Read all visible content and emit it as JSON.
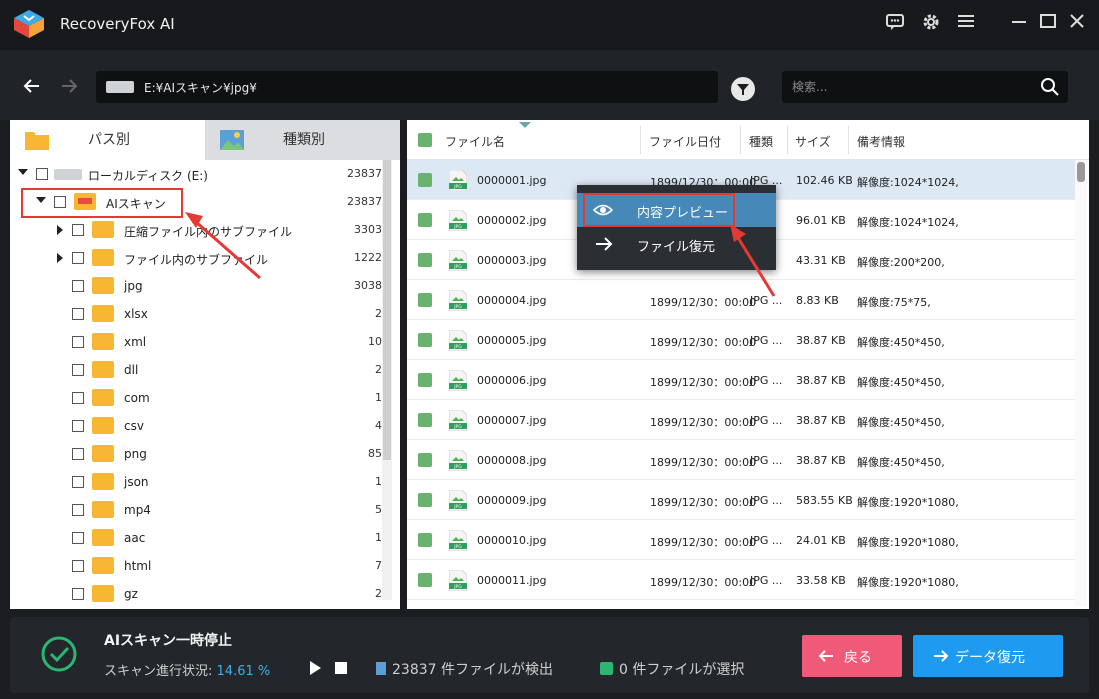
{
  "app": {
    "title": "RecoveryFox AI"
  },
  "toolbar": {
    "path": "E:¥AIスキャン¥jpg¥",
    "search_placeholder": "検索..."
  },
  "left": {
    "tabs": [
      {
        "label": "パス別"
      },
      {
        "label": "種類別"
      }
    ],
    "tree": [
      {
        "label": "ローカルディスク (E:)",
        "count": "23837"
      },
      {
        "label": "AIスキャン",
        "count": "23837"
      },
      {
        "label": "圧縮ファイル内のサブファイル",
        "count": "3303"
      },
      {
        "label": "ファイル内のサブファイル",
        "count": "1222"
      },
      {
        "label": "jpg",
        "count": "3038"
      },
      {
        "label": "xlsx",
        "count": "2"
      },
      {
        "label": "xml",
        "count": "10"
      },
      {
        "label": "dll",
        "count": "2"
      },
      {
        "label": "com",
        "count": "1"
      },
      {
        "label": "csv",
        "count": "4"
      },
      {
        "label": "png",
        "count": "85"
      },
      {
        "label": "json",
        "count": "1"
      },
      {
        "label": "mp4",
        "count": "5"
      },
      {
        "label": "aac",
        "count": "1"
      },
      {
        "label": "html",
        "count": "7"
      },
      {
        "label": "gz",
        "count": "2"
      }
    ]
  },
  "table": {
    "headers": [
      "ファイル名",
      "ファイル日付",
      "種類",
      "サイズ",
      "備考情報"
    ],
    "rows": [
      {
        "name": "0000001.jpg",
        "date": "1899/12/30：00:00",
        "type": "JPG ...",
        "size": "102.46 KB",
        "note": "解像度:1024*1024,"
      },
      {
        "name": "0000002.jpg",
        "date": "",
        "type": "",
        "size": "96.01 KB",
        "note": "解像度:1024*1024,"
      },
      {
        "name": "0000003.jpg",
        "date": "",
        "type": "",
        "size": "43.31 KB",
        "note": "解像度:200*200,"
      },
      {
        "name": "0000004.jpg",
        "date": "1899/12/30：00:00",
        "type": "JPG ...",
        "size": "8.83 KB",
        "note": "解像度:75*75,"
      },
      {
        "name": "0000005.jpg",
        "date": "1899/12/30：00:00",
        "type": "JPG ...",
        "size": "38.87 KB",
        "note": "解像度:450*450,"
      },
      {
        "name": "0000006.jpg",
        "date": "1899/12/30：00:00",
        "type": "JPG ...",
        "size": "38.87 KB",
        "note": "解像度:450*450,"
      },
      {
        "name": "0000007.jpg",
        "date": "1899/12/30：00:00",
        "type": "JPG ...",
        "size": "38.87 KB",
        "note": "解像度:450*450,"
      },
      {
        "name": "0000008.jpg",
        "date": "1899/12/30：00:00",
        "type": "JPG ...",
        "size": "38.87 KB",
        "note": "解像度:450*450,"
      },
      {
        "name": "0000009.jpg",
        "date": "1899/12/30：00:00",
        "type": "JPG ...",
        "size": "583.55 KB",
        "note": "解像度:1920*1080,"
      },
      {
        "name": "0000010.jpg",
        "date": "1899/12/30：00:00",
        "type": "JPG ...",
        "size": "24.01 KB",
        "note": "解像度:1920*1080,"
      },
      {
        "name": "0000011.jpg",
        "date": "1899/12/30：00:00",
        "type": "JPG ...",
        "size": "33.58 KB",
        "note": "解像度:1920*1080,"
      }
    ]
  },
  "context_menu": {
    "items": [
      {
        "label": "内容プレビュー"
      },
      {
        "label": "ファイル復元"
      }
    ]
  },
  "footer": {
    "title": "AIスキャン一時停止",
    "progress_label": "スキャン進行状況:",
    "progress_value": "14.61 %",
    "found_count": "23837",
    "found_suffix": "件ファイルが検出",
    "selected_count": "0",
    "selected_suffix": "件ファイルが選択",
    "back_label": "戻る",
    "recover_label": "データ復元"
  },
  "colors": {
    "accent": "#1e9bf0",
    "back": "#f05a78",
    "highlight": "#4689b8",
    "annotation": "#e53935"
  }
}
